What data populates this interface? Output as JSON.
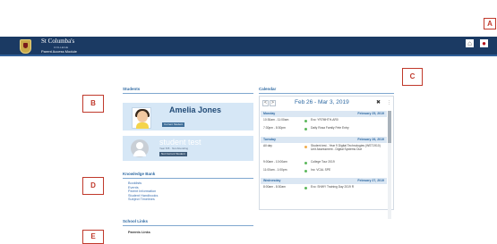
{
  "header": {
    "school_name": "St Columba's",
    "school_sub": "COLLEGE",
    "module_name": "Parent Access Module"
  },
  "markers": {
    "a": "A",
    "b": "B",
    "c": "C",
    "d": "D",
    "e": "E"
  },
  "students": {
    "title": "Students",
    "cards": [
      {
        "name": "Amelia Jones",
        "year": "Year 7",
        "badge": "Current Student"
      },
      {
        "name": "student test",
        "meta": "Year 8 B · Not Attending",
        "badge": "Not Current Student"
      }
    ]
  },
  "knowledge_bank": {
    "title": "Knowledge Bank",
    "items": [
      "Booklists",
      "Events",
      "Parent Information",
      "Student Handbooks",
      "Subject Timelines"
    ]
  },
  "school_links": {
    "title": "School Links",
    "items": [
      "Parents Links"
    ]
  },
  "calendar": {
    "title": "Calendar",
    "range": "Feb 26 - Mar 3, 2019",
    "prev": "<",
    "next": ">",
    "days": [
      {
        "name": "Monday",
        "date": "February 25, 2019",
        "events": [
          {
            "time": "10:30am - 11:00am",
            "color": "#5cb85c",
            "desc": "Exc: YR7MHTH-AR0"
          },
          {
            "time": "7:30pm - 8:30pm",
            "color": "#5cb85c",
            "desc": "Daily Rosa Family Fete Entry"
          }
        ]
      },
      {
        "name": "Tuesday",
        "date": "February 26, 2019",
        "events": [
          {
            "time": "All day",
            "color": "#f0ad4e",
            "desc": "Student test - Year 9 Digital Technologies (WST1910) Unit Assessment - Digital Systems Due"
          },
          {
            "time": "9:00am - 10:00am",
            "color": "#5cb85c",
            "desc": "College Tour 2019"
          },
          {
            "time": "11:00am - 1:00pm",
            "color": "#5cb85c",
            "desc": "Inc: VCAL SPE"
          }
        ]
      },
      {
        "name": "Wednesday",
        "date": "February 27, 2019",
        "events": [
          {
            "time": "8:00am - 8:30am",
            "color": "#5cb85c",
            "desc": "Exc: SHWY Training Day 2019 R"
          }
        ]
      }
    ]
  }
}
